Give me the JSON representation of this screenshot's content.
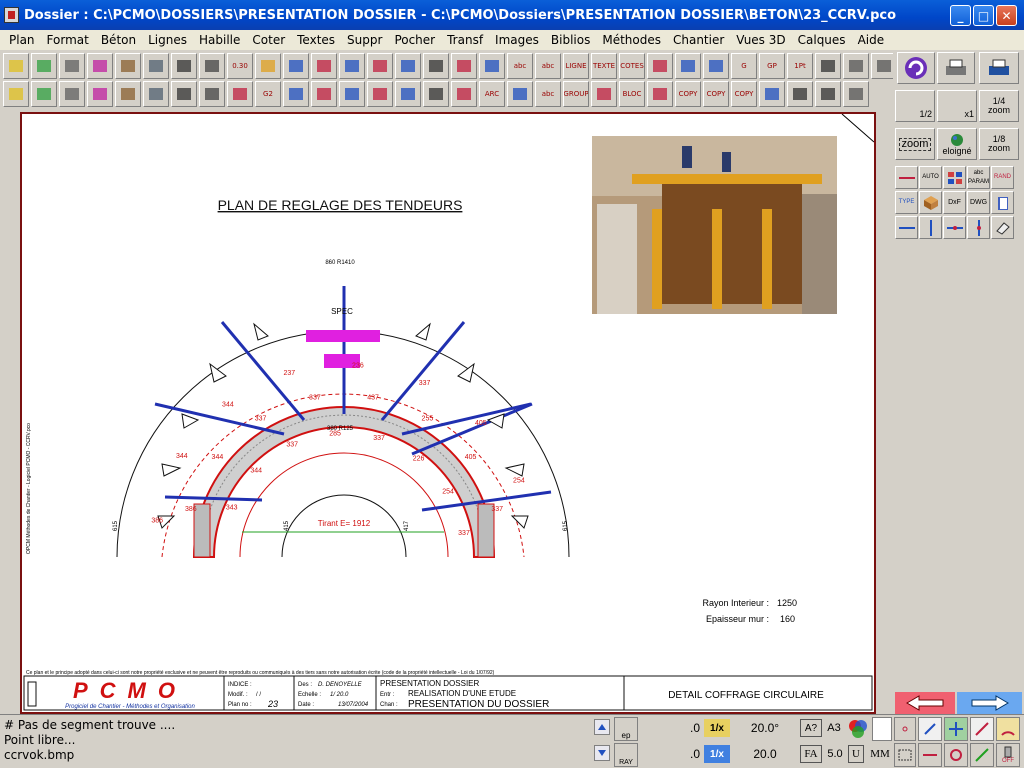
{
  "window": {
    "title": "Dossier : C:\\PCMO\\DOSSIERS\\PRESENTATION DOSSIER - C:\\PCMO\\Dossiers\\PRESENTATION DOSSIER\\BETON\\23_CCRV.pco",
    "minimize": "_",
    "maximize": "□",
    "close": "✕"
  },
  "menu": [
    "Plan",
    "Format",
    "Béton",
    "Lignes",
    "Habille",
    "Coter",
    "Textes",
    "Suppr",
    "Pocher",
    "Transf",
    "Images",
    "Biblios",
    "Méthodes",
    "Chantier",
    "Vues 3D",
    "Calques",
    "Aide"
  ],
  "toolbar": {
    "row1_labels": [
      "",
      "",
      "",
      "",
      "",
      "",
      "",
      "",
      "0.30",
      "",
      "",
      "",
      "",
      "",
      "",
      "",
      "",
      "",
      "abc",
      "abc",
      "LIGNE",
      "TEXTE",
      "COTES",
      "",
      "",
      "",
      "G",
      "GP",
      "1Pt",
      "",
      "",
      ""
    ],
    "row2_labels": [
      "",
      "",
      "",
      "",
      "",
      "",
      "",
      "",
      "",
      "G2",
      "",
      "",
      "",
      "",
      "",
      "",
      "",
      "ARC",
      "",
      "abc",
      "GROUP",
      "",
      "BLOC",
      "",
      "COPY",
      "COPY",
      "COPY",
      "",
      "",
      "",
      ""
    ],
    "accent": "#c02040"
  },
  "drawing": {
    "title": "PLAN DE REGLAGE DES TENDEURS",
    "top_label": "SPEC",
    "outer_dim": "860 R1410",
    "inner_dim": "380 R125",
    "tirant": "Tirant E= 1912",
    "labels_red": [
      "386",
      "386",
      "343",
      "344",
      "344",
      "344",
      "344",
      "337",
      "337",
      "237",
      "337",
      "285",
      "236",
      "437",
      "337",
      "337",
      "255",
      "226",
      "405",
      "405",
      "254",
      "254",
      "337",
      "337"
    ],
    "dim_side_left": "615",
    "dim_side_right": "615",
    "inner_left": "415",
    "inner_right": "417",
    "rayon_label": "Rayon Interieur :",
    "rayon_value": "1250",
    "epaisseur_label": "Epaisseur   mur :",
    "epaisseur_value": "160",
    "side_vertical_text": "OPCM Méthodes de Chantier - Logiciel PCMO - CCRV.pco",
    "copyright": "Ce plan et le principe adopté dans celui-ci sont notre propriété exclusive et ne peuvent être reproduits ou communiqués à des tiers sans notre autorisation écrite (code de la propriété intellectuelle - Loi du 1/07/92)"
  },
  "cartouche": {
    "logo": "PCMO",
    "logo_sub": "Progiciel de Chantier - Méthodes et Organisation",
    "indice_label": "INDICE :",
    "modif_label": "Modif. :",
    "modif_value": "/ /",
    "planno_label": "Plan no :",
    "planno_value": "23",
    "des_label": "Des :",
    "des_value": "D. DENOYELLE",
    "echelle_label": "Echelle :",
    "echelle_value": "1/  20.0",
    "date_label": "Date :",
    "date_value": "13/07/2004",
    "line1": "PRESENTATION DOSSIER",
    "entr_label": "Entr :",
    "entr_value": "REALISATION D'UNE ETUDE",
    "chan_label": "Chan :",
    "chan_value": "PRESENTATION DU DOSSIER",
    "detail": "DETAIL COFFRAGE CIRCULAIRE"
  },
  "right_panel": {
    "zoom_half": "1/2",
    "zoom_x1": "x1",
    "zoom_quarter": "1/4",
    "zoom_word": "zoom",
    "zoom_btn": "zoom",
    "eloigne": "eloigné",
    "zoom_eighth": "1/8",
    "auto": "AUTO",
    "abc": "abc",
    "param": "PARAM",
    "rand": "RAND",
    "type": "TYPE",
    "dxf": "DxF",
    "dwg": "DWG"
  },
  "status": {
    "messages": [
      "# Pas de segment trouve ....",
      "Point libre...",
      "ccrvok.bmp"
    ],
    "ep": "ep",
    "ray": "RAY",
    "val1": ".0",
    "val2": ".0",
    "onex_a": "1/x",
    "onex_b": "1/x",
    "angle1": "20.0°",
    "angle2": "20.0",
    "help": "A?",
    "format": "A3",
    "fa": "FA",
    "fa_val": "5.0",
    "u": "U",
    "mm": "MM",
    "off": "OFF"
  }
}
